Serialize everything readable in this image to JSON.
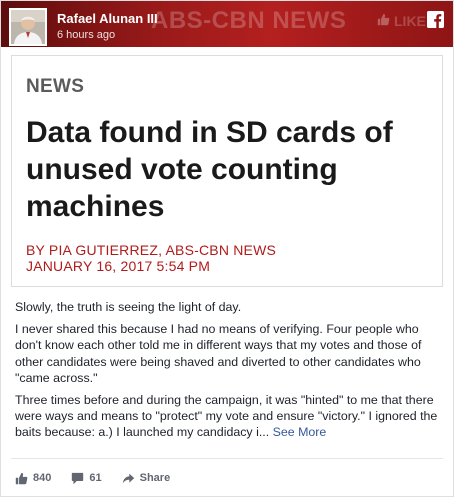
{
  "header": {
    "author_name": "Rafael Alunan III",
    "post_time": "6 hours ago",
    "banner_watermark": "ABS-CBN NEWS",
    "banner_like": "LIKE"
  },
  "article": {
    "section": "NEWS",
    "headline": "Data found in SD cards of unused vote counting machines",
    "byline": "BY PIA GUTIERREZ, ABS-CBN NEWS",
    "date": "JANUARY 16, 2017 5:54 PM"
  },
  "body": {
    "paragraphs": [
      "Slowly, the truth is seeing the light of day.",
      "I never shared this because I had no means of verifying. Four people who don't know each other told me in different ways that my votes and those of other candidates were being shaved and diverted to other candidates who \"came across.\"",
      "Three times before and during the campaign, it was \"hinted\" to me that there were ways and means to \"protect\" my vote and ensure \"victory.\" I ignored the baits because: a.) I launched my candidacy i..."
    ],
    "see_more": "See More"
  },
  "actions": {
    "likes": "840",
    "comments": "61",
    "share": "Share"
  },
  "colors": {
    "banner": "#9a1a1a",
    "byline": "#b01c1c",
    "link": "#365899",
    "action_gray": "#606770"
  },
  "icons": [
    "facebook-icon",
    "like-icon",
    "comment-icon",
    "share-icon",
    "thumbs-up-icon"
  ]
}
